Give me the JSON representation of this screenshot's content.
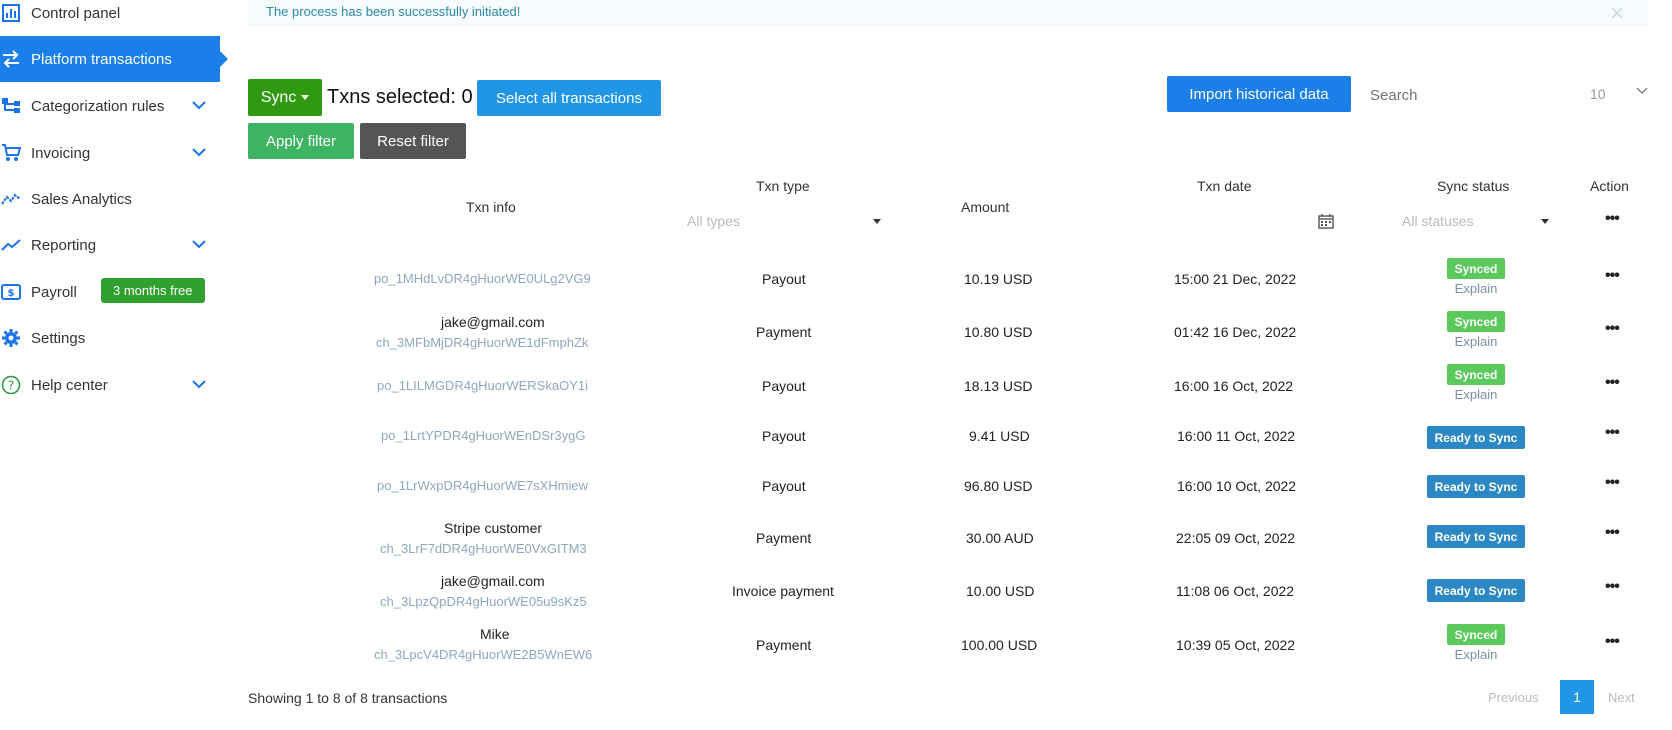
{
  "sidebar": {
    "items": [
      {
        "label": "Control panel",
        "icon": "bar-chart-icon"
      },
      {
        "label": "Platform transactions",
        "icon": "transfer-arrows-icon",
        "active": true
      },
      {
        "label": "Categorization rules",
        "icon": "hierarchy-icon",
        "chevron": true
      },
      {
        "label": "Invoicing",
        "icon": "cart-icon",
        "chevron": true
      },
      {
        "label": "Sales Analytics",
        "icon": "trend-icon"
      },
      {
        "label": "Reporting",
        "icon": "line-chart-icon",
        "chevron": true
      },
      {
        "label": "Payroll",
        "icon": "dollar-card-icon",
        "badge": "3 months free"
      },
      {
        "label": "Settings",
        "icon": "gear-icon"
      },
      {
        "label": "Help center",
        "icon": "question-circle-icon",
        "chevron": true
      }
    ]
  },
  "alert": {
    "text": "The process has been successfully initiated!",
    "close": "×"
  },
  "toolbar": {
    "sync_label": "Sync",
    "selected_text": "Txns selected: 0",
    "select_all_label": "Select all transactions",
    "apply_filter_label": "Apply filter",
    "reset_filter_label": "Reset filter",
    "import_label": "Import historical data",
    "search_placeholder": "Search",
    "page_size": "10"
  },
  "table": {
    "headers": {
      "txn_info": "Txn info",
      "txn_type": "Txn type",
      "amount": "Amount",
      "txn_date": "Txn date",
      "sync_status": "Sync status",
      "action": "Action"
    },
    "filters": {
      "types_placeholder": "All types",
      "statuses_placeholder": "All statuses"
    },
    "action_dots": "•••",
    "rows": [
      {
        "name": "",
        "id": "po_1MHdLvDR4gHuorWE0ULg2VG9",
        "type": "Payout",
        "amount": "10.19 USD",
        "date": "15:00 21 Dec, 2022",
        "status": "Synced",
        "explain": "Explain"
      },
      {
        "name": "jake@gmail.com",
        "id": "ch_3MFbMjDR4gHuorWE1dFmphZk",
        "type": "Payment",
        "amount": "10.80 USD",
        "date": "01:42 16 Dec, 2022",
        "status": "Synced",
        "explain": "Explain"
      },
      {
        "name": "",
        "id": "po_1LILMGDR4gHuorWERSkaOY1i",
        "type": "Payout",
        "amount": "18.13 USD",
        "date": "16:00 16 Oct, 2022",
        "status": "Synced",
        "explain": "Explain"
      },
      {
        "name": "",
        "id": "po_1LrtYPDR4gHuorWEnDSr3ygG",
        "type": "Payout",
        "amount": "9.41 USD",
        "date": "16:00 11 Oct, 2022",
        "status": "Ready to Sync",
        "explain": ""
      },
      {
        "name": "",
        "id": "po_1LrWxpDR4gHuorWE7sXHmiew",
        "type": "Payout",
        "amount": "96.80 USD",
        "date": "16:00 10 Oct, 2022",
        "status": "Ready to Sync",
        "explain": ""
      },
      {
        "name": "Stripe customer",
        "id": "ch_3LrF7dDR4gHuorWE0VxGITM3",
        "type": "Payment",
        "amount": "30.00 AUD",
        "date": "22:05 09 Oct, 2022",
        "status": "Ready to Sync",
        "explain": ""
      },
      {
        "name": "jake@gmail.com",
        "id": "ch_3LpzQpDR4gHuorWE05u9sKz5",
        "type": "Invoice payment",
        "amount": "10.00 USD",
        "date": "11:08 06 Oct, 2022",
        "status": "Ready to Sync",
        "explain": ""
      },
      {
        "name": "Mike",
        "id": "ch_3LpcV4DR4gHuorWE2B5WnEW6",
        "type": "Payment",
        "amount": "100.00 USD",
        "date": "10:39 05 Oct, 2022",
        "status": "Synced",
        "explain": "Explain"
      }
    ]
  },
  "footer": {
    "info": "Showing 1 to 8 of 8 transactions",
    "prev": "Previous",
    "current_page": "1",
    "next": "Next"
  },
  "colors": {
    "primary": "#1a7fe8",
    "sync_green": "#2f9a10",
    "synced_badge": "#5bc95b",
    "ready_badge": "#2b88c4"
  }
}
